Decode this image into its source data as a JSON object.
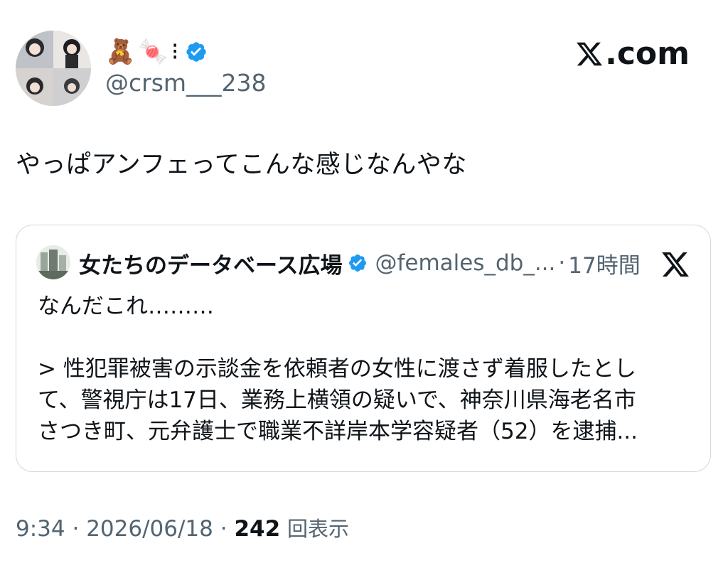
{
  "author": {
    "display_name_emojis": [
      "🧸",
      "🍬",
      "⁝"
    ],
    "handle": "@crsm___238",
    "verified": true
  },
  "brand": {
    "label": ".com",
    "logo_icon": "x-logo-icon"
  },
  "tweet": {
    "text": "やっぱアンフェってこんな感じなんやな"
  },
  "quote": {
    "name": "女たちのデータベース広場",
    "handle": "@females_db_...",
    "separator": "·",
    "time": "17時間",
    "verified": true,
    "body_first": "なんだこれ………",
    "body_lines": [
      "> 性犯罪被害の示談金を依頼者の女性に渡さず着服したとし",
      "て、警視庁は17日、業務上横領の疑いで、神奈川県海老名市",
      "さつき町、元弁護士で職業不詳岸本学容疑者（52）を逮捕..."
    ]
  },
  "meta": {
    "time": "9:34",
    "separator": "·",
    "date": "2026/06/18",
    "views_count": "242",
    "views_label": "回表示"
  },
  "colors": {
    "verified_blue": "#1d9bf0",
    "secondary_text": "#536471",
    "primary_text": "#0f1419",
    "border": "#cfd9de"
  }
}
